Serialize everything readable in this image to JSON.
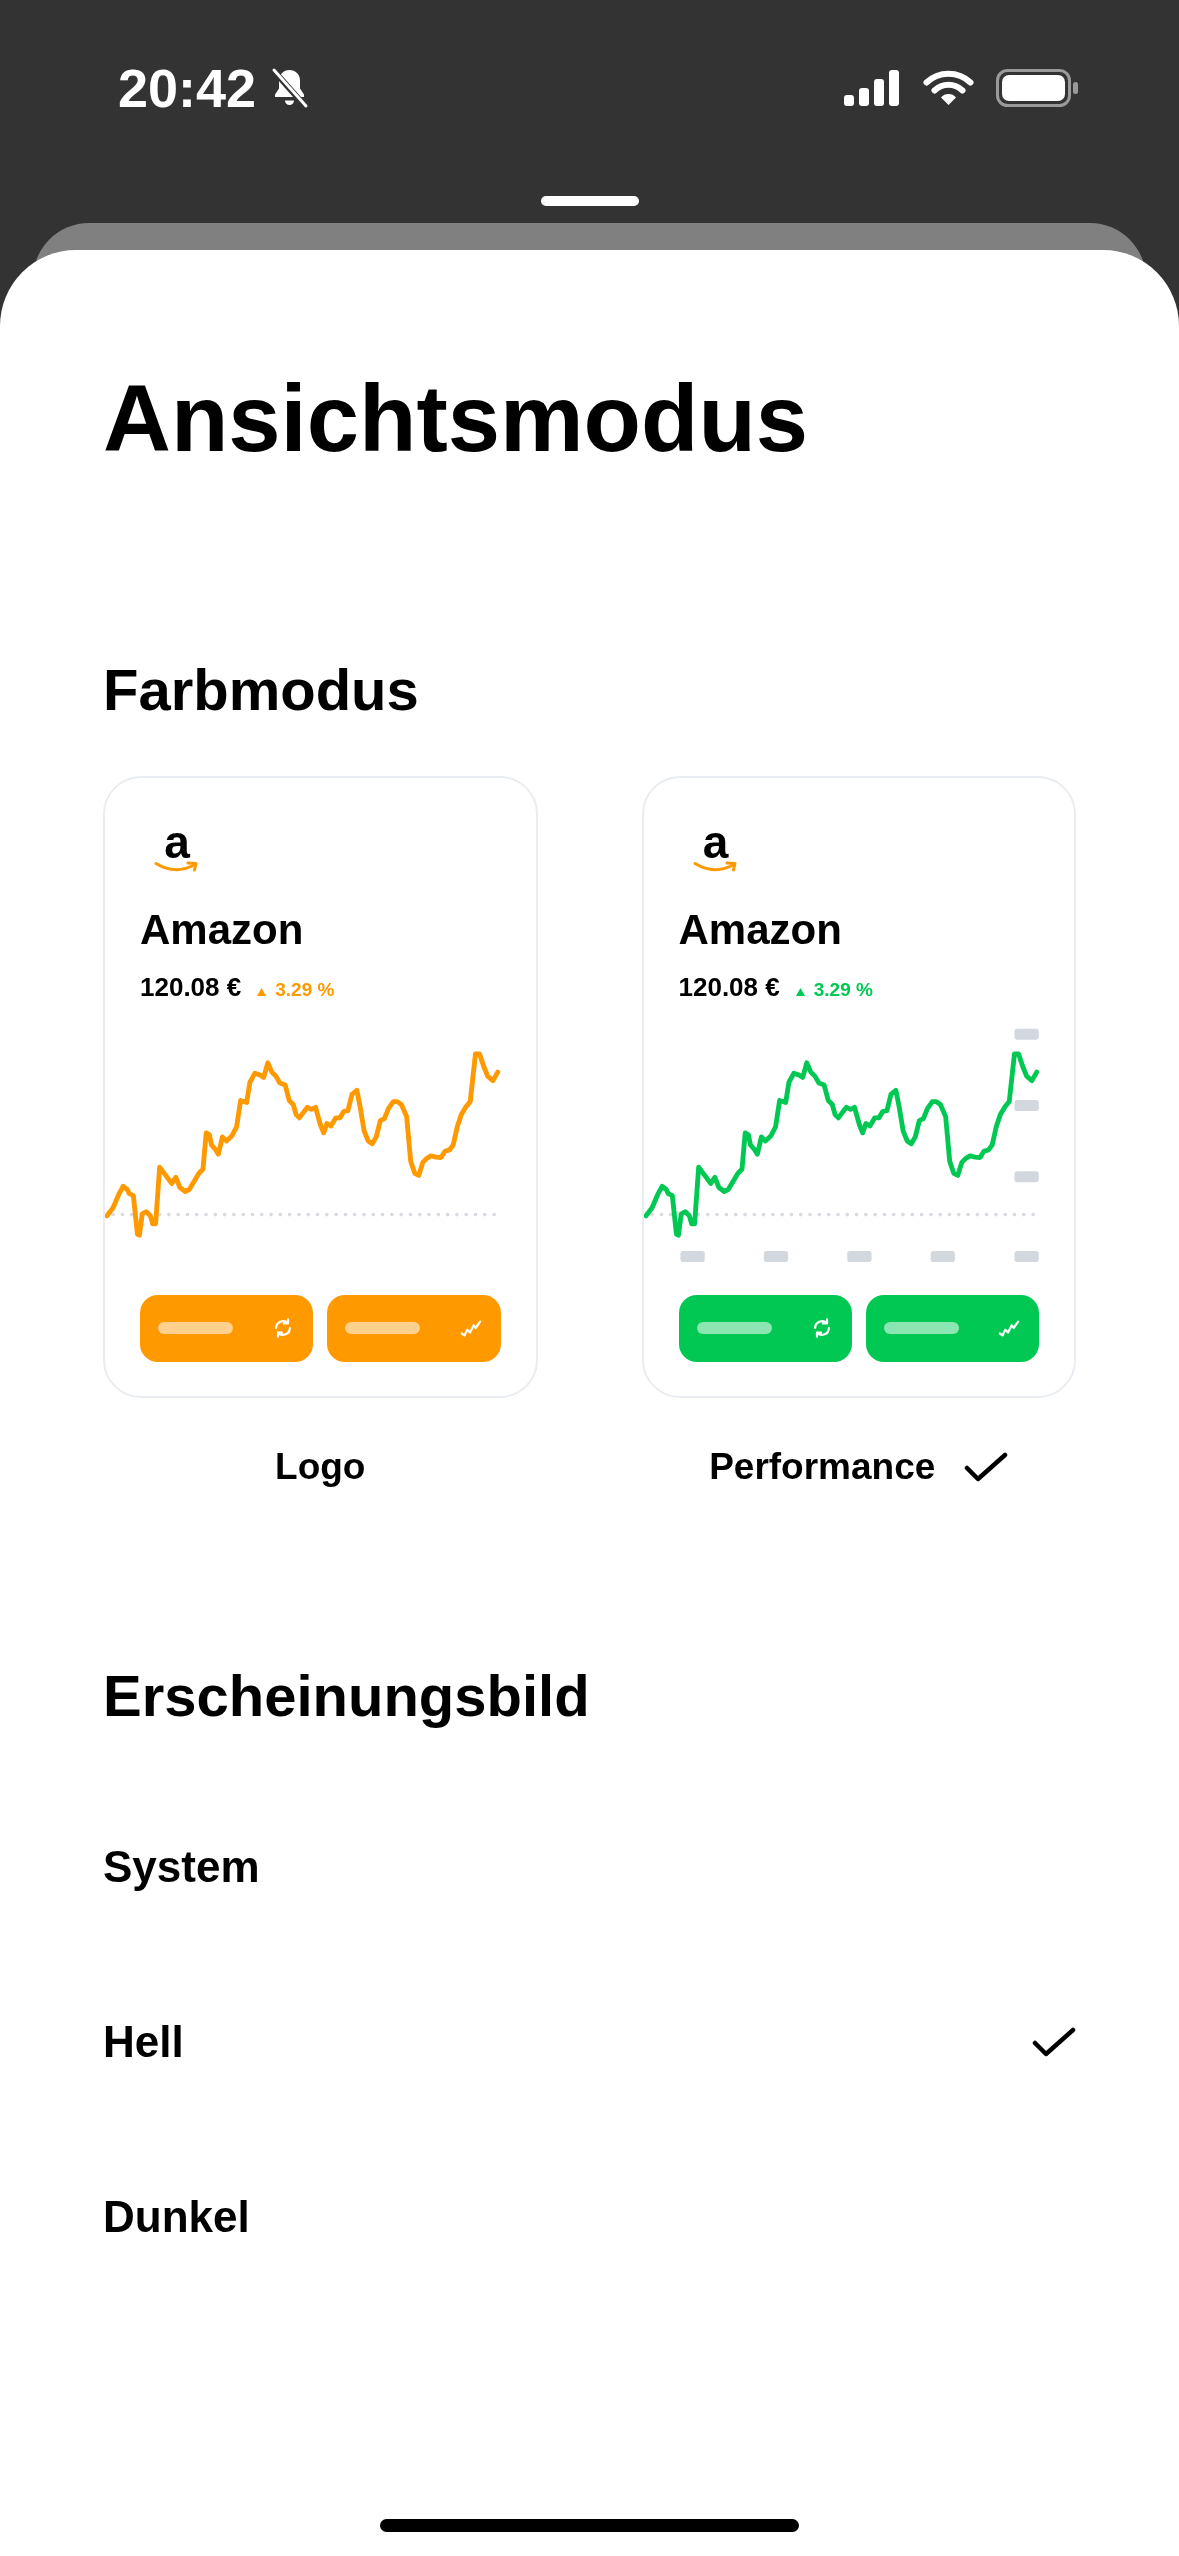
{
  "status_bar": {
    "time": "20:42"
  },
  "title": "Ansichtsmodus",
  "color_mode": {
    "heading": "Farbmodus",
    "options": [
      {
        "kind": "logo",
        "label": "Logo",
        "selected": false,
        "color": "#ff9900",
        "preview": {
          "logo_letter": "a",
          "name": "Amazon",
          "price": "120.08 €",
          "change": "3.29 %"
        }
      },
      {
        "kind": "performance",
        "label": "Performance",
        "selected": true,
        "color": "#00c853",
        "preview": {
          "logo_letter": "a",
          "name": "Amazon",
          "price": "120.08 €",
          "change": "3.29 %"
        }
      }
    ]
  },
  "appearance": {
    "heading": "Erscheinungsbild",
    "options": [
      {
        "label": "System",
        "selected": false
      },
      {
        "label": "Hell",
        "selected": true
      },
      {
        "label": "Dunkel",
        "selected": false
      }
    ]
  }
}
